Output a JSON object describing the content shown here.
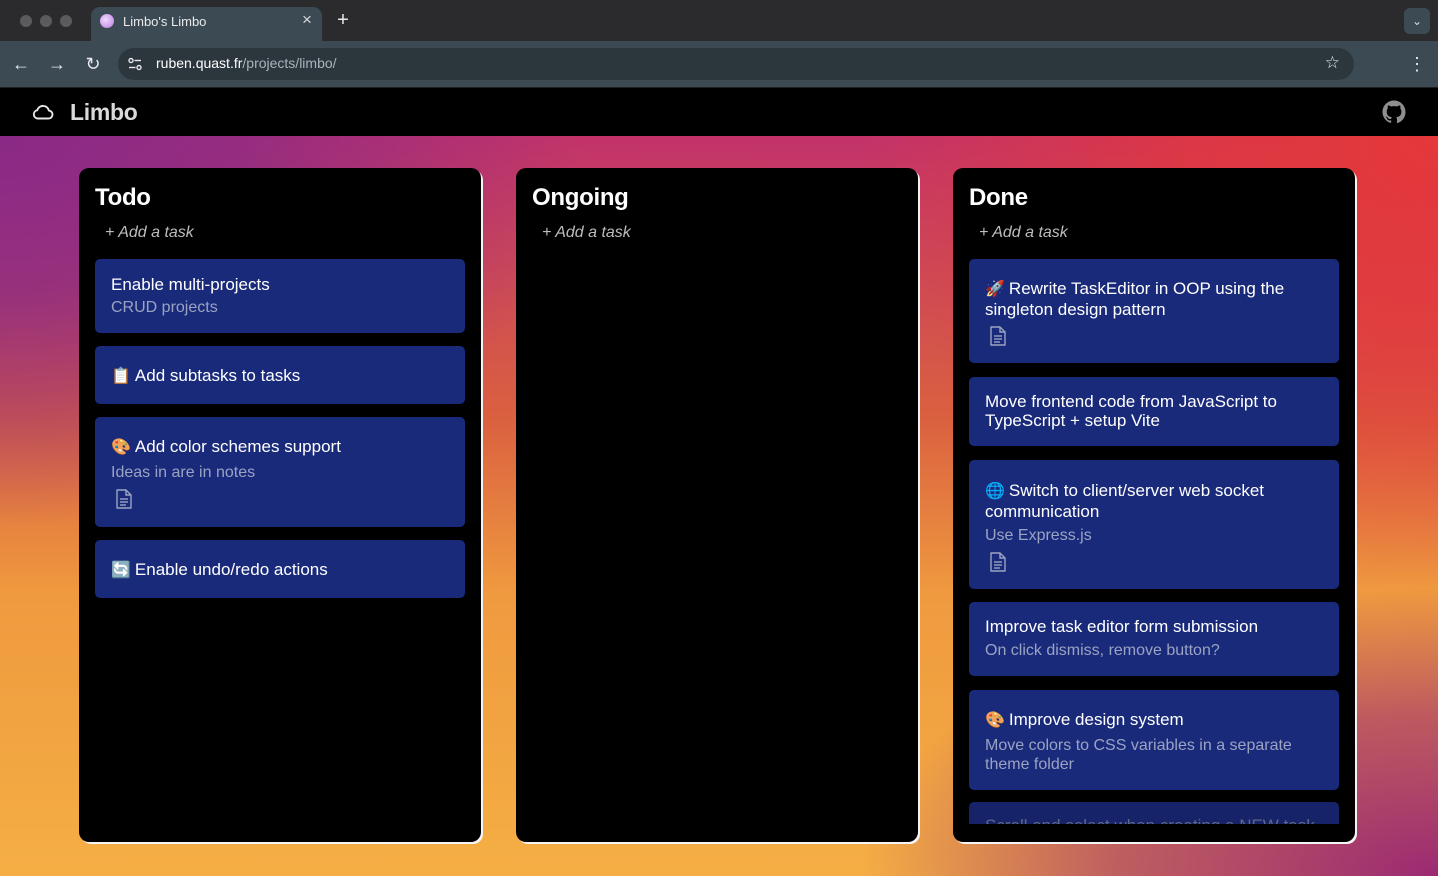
{
  "browser": {
    "tab_title": "Limbo's Limbo",
    "url_host": "ruben.quast.fr",
    "url_path": "/projects/limbo/"
  },
  "app": {
    "name": "Limbo"
  },
  "columns": [
    {
      "title": "Todo",
      "add_label": "+ Add a task",
      "cards": [
        {
          "title": "Enable multi-projects",
          "subtitle": "CRUD projects"
        },
        {
          "emoji": "📋",
          "title": "Add subtasks to tasks"
        },
        {
          "emoji": "🎨",
          "title": "Add color schemes support",
          "subtitle": "Ideas in are in notes",
          "note_icon": "document-icon"
        },
        {
          "emoji": "🔄",
          "title": "Enable undo/redo actions"
        }
      ]
    },
    {
      "title": "Ongoing",
      "add_label": "+ Add a task",
      "cards": []
    },
    {
      "title": "Done",
      "add_label": "+ Add a task",
      "cards": [
        {
          "emoji": "🚀",
          "title": "Rewrite TaskEditor in OOP using the singleton design pattern",
          "note_icon": "document-icon"
        },
        {
          "title": "Move frontend code from JavaScript to TypeScript + setup Vite"
        },
        {
          "emoji": "🌐",
          "title": "Switch to client/server web socket communication",
          "subtitle": "Use Express.js",
          "note_icon": "document-icon"
        },
        {
          "title": "Improve task editor form submission",
          "subtitle": "On click dismiss, remove button?"
        },
        {
          "emoji": "🎨",
          "title": "Improve design system",
          "subtitle": "Move colors to CSS variables in a separate theme folder"
        },
        {
          "title": "Scroll and select when creating a NEW task"
        }
      ]
    }
  ]
}
